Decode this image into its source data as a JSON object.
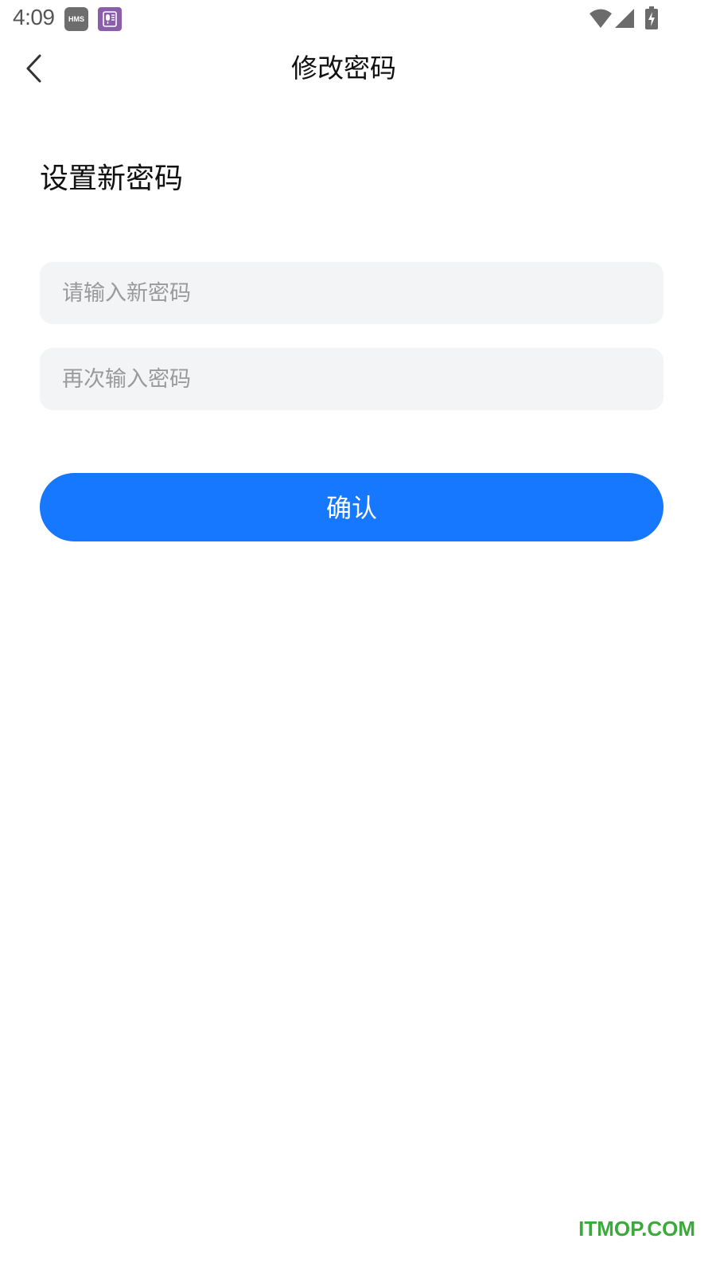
{
  "status_bar": {
    "time": "4:09",
    "hms_label": "HMS",
    "icons": [
      "hms-icon",
      "voice-recorder-icon",
      "wifi-icon",
      "signal-icon",
      "battery-charging-icon"
    ]
  },
  "header": {
    "title": "修改密码",
    "back_icon": "chevron-left-icon"
  },
  "form": {
    "heading": "设置新密码",
    "new_password": {
      "value": "",
      "placeholder": "请输入新密码"
    },
    "confirm_password": {
      "value": "",
      "placeholder": "再次输入密码"
    },
    "submit_label": "确认"
  },
  "colors": {
    "accent": "#1677ff",
    "input_background": "#f3f4f6",
    "placeholder": "#9a9a9a",
    "watermark": "#3aaa3a"
  },
  "watermark": "ITMOP.COM"
}
